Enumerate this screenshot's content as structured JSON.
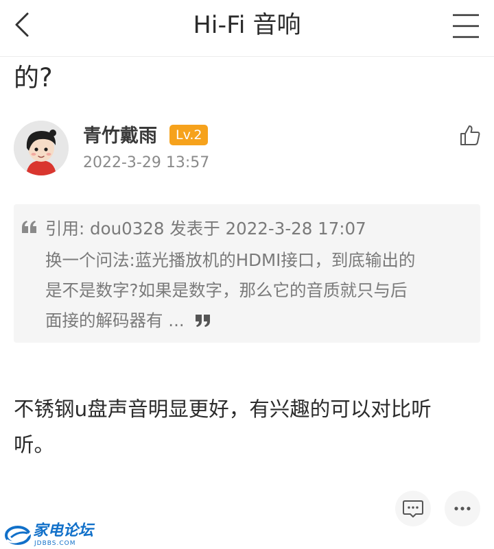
{
  "header": {
    "title": "Hi-Fi 音响"
  },
  "post": {
    "title_tail": "的?"
  },
  "reply": {
    "author": {
      "name": "青竹戴雨",
      "level": "Lv.2",
      "date": "2022-3-29 13:57"
    },
    "quote": {
      "line1": "引用: dou0328 发表于 2022-3-28 17:07",
      "line2": "换一个问法:蓝光播放机的HDMI接口，到底输出的",
      "line3": "是不是数字?如果是数字，那么它的音质就只与后",
      "line4": "面接的解码器有 ..."
    },
    "content": {
      "line1": "不锈钢u盘声音明显更好，有兴趣的可以对比听",
      "line2": "听。"
    }
  },
  "watermark": {
    "text": "家电论坛",
    "sub": "JDBBS.COM"
  },
  "icons": {
    "back": "chevron-left-icon",
    "menu": "menu-icon",
    "like": "thumbs-up-icon",
    "comment": "comment-icon",
    "more": "more-icon",
    "quote": "quote-icon"
  },
  "colors": {
    "level_badge": "#f6a21c",
    "watermark": "#1170c9",
    "quote_bg": "#f5f5f5"
  }
}
